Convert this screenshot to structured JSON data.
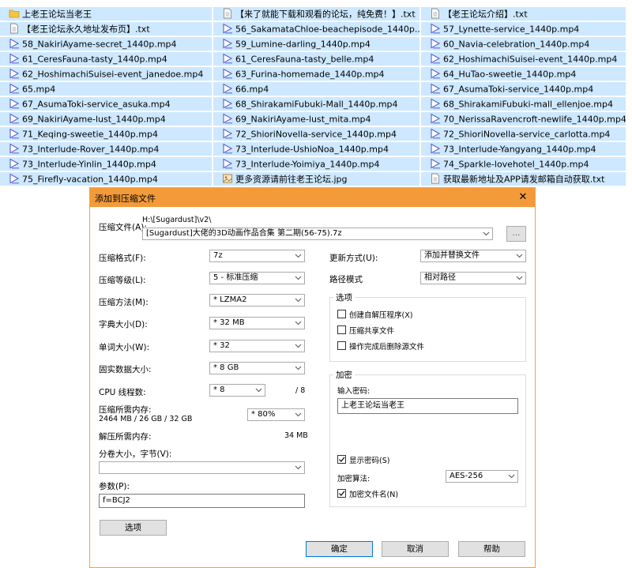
{
  "file_list": {
    "rows": [
      [
        {
          "icon": "folder-icon",
          "name": "上老王论坛当老王"
        },
        {
          "icon": "text-file-icon",
          "name": "【来了就能下载和观看的论坛，纯免费！】.txt"
        },
        {
          "icon": "text-file-icon",
          "name": "【老王论坛介绍】.txt"
        }
      ],
      [
        {
          "icon": "text-file-icon",
          "name": "【老王论坛永久地址发布页】.txt"
        },
        {
          "icon": "video-file-icon",
          "name": "56_SakamataChloe-beachepisode_1440p...."
        },
        {
          "icon": "video-file-icon",
          "name": "57_Lynette-service_1440p.mp4"
        }
      ],
      [
        {
          "icon": "video-file-icon",
          "name": "58_NakiriAyame-secret_1440p.mp4"
        },
        {
          "icon": "video-file-icon",
          "name": "59_Lumine-darling_1440p.mp4"
        },
        {
          "icon": "video-file-icon",
          "name": "60_Navia-celebration_1440p.mp4"
        }
      ],
      [
        {
          "icon": "video-file-icon",
          "name": "61_CeresFauna-tasty_1440p.mp4"
        },
        {
          "icon": "video-file-icon",
          "name": "61_CeresFauna-tasty_belle.mp4"
        },
        {
          "icon": "video-file-icon",
          "name": "62_HoshimachiSuisei-event_1440p.mp4"
        }
      ],
      [
        {
          "icon": "video-file-icon",
          "name": "62_HoshimachiSuisei-event_janedoe.mp4"
        },
        {
          "icon": "video-file-icon",
          "name": "63_Furina-homemade_1440p.mp4"
        },
        {
          "icon": "video-file-icon",
          "name": "64_HuTao-sweetie_1440p.mp4"
        }
      ],
      [
        {
          "icon": "video-file-icon",
          "name": "65.mp4"
        },
        {
          "icon": "video-file-icon",
          "name": "66.mp4"
        },
        {
          "icon": "video-file-icon",
          "name": "67_AsumaToki-service_1440p.mp4"
        }
      ],
      [
        {
          "icon": "video-file-icon",
          "name": "67_AsumaToki-service_asuka.mp4"
        },
        {
          "icon": "video-file-icon",
          "name": "68_ShirakamiFubuki-Mall_1440p.mp4"
        },
        {
          "icon": "video-file-icon",
          "name": "68_ShirakamiFubuki-mall_ellenjoe.mp4"
        }
      ],
      [
        {
          "icon": "video-file-icon",
          "name": "69_NakiriAyame-lust_1440p.mp4"
        },
        {
          "icon": "video-file-icon",
          "name": "69_NakiriAyame-lust_mita.mp4"
        },
        {
          "icon": "video-file-icon",
          "name": "70_NerissaRavencroft-newlife_1440p.mp4"
        }
      ],
      [
        {
          "icon": "video-file-icon",
          "name": "71_Keqing-sweetie_1440p.mp4"
        },
        {
          "icon": "video-file-icon",
          "name": "72_ShioriNovella-service_1440p.mp4"
        },
        {
          "icon": "video-file-icon",
          "name": "72_ShioriNovella-service_carlotta.mp4"
        }
      ],
      [
        {
          "icon": "video-file-icon",
          "name": "73_Interlude-Rover_1440p.mp4"
        },
        {
          "icon": "video-file-icon",
          "name": "73_Interlude-UshioNoa_1440p.mp4"
        },
        {
          "icon": "video-file-icon",
          "name": "73_Interlude-Yangyang_1440p.mp4"
        }
      ],
      [
        {
          "icon": "video-file-icon",
          "name": "73_Interlude-Yinlin_1440p.mp4"
        },
        {
          "icon": "video-file-icon",
          "name": "73_Interlude-Yoimiya_1440p.mp4"
        },
        {
          "icon": "video-file-icon",
          "name": "74_Sparkle-lovehotel_1440p.mp4"
        }
      ],
      [
        {
          "icon": "video-file-icon",
          "name": "75_Firefly-vacation_1440p.mp4"
        },
        {
          "icon": "image-file-icon",
          "name": "更多资源请前往老王论坛.jpg"
        },
        {
          "icon": "text-file-icon",
          "name": "获取最新地址及APP请发邮箱自动获取.txt"
        }
      ]
    ]
  },
  "dialog": {
    "title": "添加到压缩文件",
    "close_glyph": "✕",
    "archive": {
      "label": "压缩文件(A):",
      "path": "H:\\[Sugardust]\\v2\\",
      "value": "[Sugardust]大佬的3D动画作品合集 第二期(56-75).7z",
      "browse_label": "..."
    },
    "format": {
      "label": "压缩格式(F):",
      "value": "7z"
    },
    "level": {
      "label": "压缩等级(L):",
      "value": "5 - 标准压缩"
    },
    "method": {
      "label": "压缩方法(M):",
      "value": "* LZMA2"
    },
    "dict": {
      "label": "字典大小(D):",
      "value": "* 32 MB"
    },
    "word": {
      "label": "单词大小(W):",
      "value": "* 32"
    },
    "solid": {
      "label": "固实数据大小:",
      "value": "* 8 GB"
    },
    "threads": {
      "label": "CPU 线程数:",
      "value": "* 8",
      "max": "/ 8"
    },
    "memory": {
      "label": "压缩所需内存:",
      "detail": "2464 MB / 26 GB / 32 GB",
      "value": "* 80%"
    },
    "decomp_memory": {
      "label": "解压所需内存:",
      "value": "34 MB"
    },
    "volume": {
      "label": "分卷大小，字节(V):",
      "value": ""
    },
    "params": {
      "label": "参数(P):",
      "value": "f=BCJ2"
    },
    "options_button": "选项",
    "update_mode": {
      "label": "更新方式(U):",
      "value": "添加并替换文件"
    },
    "path_mode": {
      "label": "路径模式",
      "value": "相对路径"
    },
    "options_group": {
      "title": "选项",
      "sfx": {
        "label": "创建自解压程序(X)",
        "checked": false
      },
      "shared": {
        "label": "压缩共享文件",
        "checked": false
      },
      "delete": {
        "label": "操作完成后删除源文件",
        "checked": false
      }
    },
    "encryption": {
      "title": "加密",
      "password_label": "输入密码:",
      "password": "上老王论坛当老王",
      "show_password": {
        "label": "显示密码(S)",
        "checked": true
      },
      "method_label": "加密算法:",
      "method_value": "AES-256",
      "encrypt_names": {
        "label": "加密文件名(N)",
        "checked": true
      }
    },
    "buttons": {
      "ok": "确定",
      "cancel": "取消",
      "help": "帮助"
    },
    "colors": {
      "titlebar": "#f39a3a",
      "border": "#f1a145",
      "selection": "#cde8ff"
    }
  }
}
